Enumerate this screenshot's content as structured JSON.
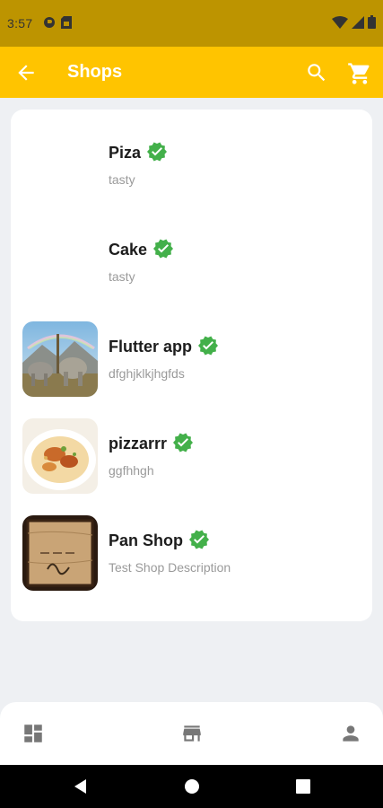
{
  "status_bar": {
    "time": "3:57"
  },
  "app_bar": {
    "title": "Shops",
    "back_icon": "arrow-back-icon",
    "search_icon": "search-icon",
    "cart_icon": "shopping-cart-icon",
    "background": "#ffc400",
    "title_color": "#ffffff"
  },
  "shops": [
    {
      "name": "Piza",
      "description": "tasty",
      "image": "none"
    },
    {
      "name": "Cake",
      "description": "tasty",
      "image": "none"
    },
    {
      "name": "Flutter app",
      "description": "dfghjklkjhgfds",
      "image": "elephants-landscape"
    },
    {
      "name": "pizzarrr",
      "description": "ggfhhgh",
      "image": "biryani-dish"
    },
    {
      "name": "Pan Shop",
      "description": "Test Shop Description",
      "image": "welcome-sign"
    }
  ],
  "verified_badge": {
    "icon": "verified-check-icon",
    "color": "#43b04a"
  },
  "bottom_nav": [
    {
      "icon": "dashboard-icon"
    },
    {
      "icon": "store-icon"
    },
    {
      "icon": "person-icon"
    }
  ],
  "system_nav": [
    {
      "icon": "back-triangle-icon"
    },
    {
      "icon": "home-circle-icon"
    },
    {
      "icon": "recents-square-icon"
    }
  ]
}
